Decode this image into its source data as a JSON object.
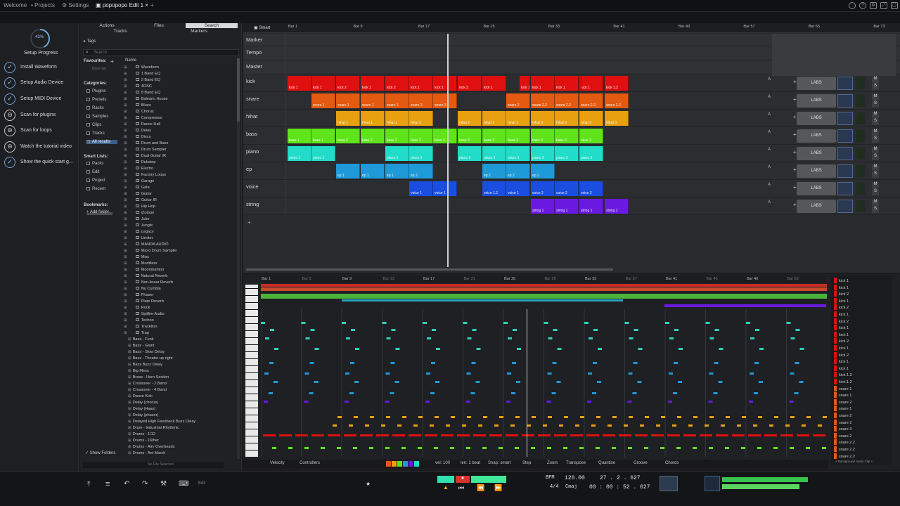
{
  "topbar": {
    "tabs": [
      "Welcome",
      "Projects",
      "Settings",
      "popopopo Edit 1"
    ],
    "add_tab": "+"
  },
  "setup": {
    "progress_pct": "43%",
    "progress_value": 0.43,
    "title": "Setup Progress",
    "items": [
      "Install Waveform",
      "Setup Audio Device",
      "Setup MIDI Device",
      "Scan for plugins",
      "Scan for loops",
      "Watch the tutorial video",
      "Show the quick start g..."
    ]
  },
  "browser": {
    "tabs": [
      "Actions",
      "Files",
      "Search",
      "Tracks",
      "Markers"
    ],
    "tags": "Tags",
    "search_placeholder": "Search",
    "favourites": "Favourites:",
    "none_set": "None set",
    "name_header": "Name",
    "categories_title": "Categories:",
    "categories": [
      "Plugins",
      "Presets",
      "Racks",
      "Samples",
      "Clips",
      "Tracks",
      "All results"
    ],
    "smart_title": "Smart Lists:",
    "smart": [
      "Packs",
      "Edit",
      "Project",
      "Recent"
    ],
    "bookmarks_title": "Bookmarks:",
    "add_folder": "Add folder...",
    "folders": [
      "Waveform",
      "1 Band EQ",
      "2 Band EQ",
      "4OSC",
      "8 Band EQ",
      "Balearic House",
      "Blues",
      "Chorus",
      "Compressor",
      "Dance Hall",
      "Delay",
      "Disco",
      "Drum and Bass",
      "Drum Sampler",
      "Dual Guitar IR",
      "Dubstep",
      "Electro",
      "Factory Loops",
      "Garage",
      "Gate",
      "Guitar",
      "Guitar IR",
      "Hip Hop",
      "iZotope",
      "Juke",
      "Jungle",
      "Legacy",
      "Limiter",
      "MANDA AUDIO",
      "Micro Drum Sampler",
      "Misc",
      "Modifiers",
      "Moombahton",
      "Natural Reverb",
      "Non-linear Reverb",
      "Nu Cumbia",
      "Phaser",
      "Plate Reverb",
      "Rock",
      "Spitfire Audio",
      "Techno",
      "Tracktion",
      "Trap"
    ],
    "presets": [
      "Bass - Funk",
      "Bass - Giant",
      "Bass - Slow Delay",
      "Bass - Theatre up right",
      "Bass Buzz Delay",
      "Big Mess",
      "Brass - Horn Section",
      "Crossover - 2 Band",
      "Crossover - 4 Band",
      "Dance Kick",
      "Delay (chorus)",
      "Delay (Haas)",
      "Delay (phaser)",
      "Delayed High Feedback Buzz Delay",
      "Drum - Industrial Rhythmic",
      "Drums - 1/12",
      "Drums - 16ther",
      "Drums - Airy Overheads",
      "Drums - Ant March"
    ],
    "show_folders": "Show Folders",
    "no_file": "No File Selected"
  },
  "arranger": {
    "smart": "Smart",
    "bars": [
      "Bar 1",
      "Bar 9",
      "Bar 17",
      "Bar 25",
      "Bar 33",
      "Bar 41",
      "Bar 49",
      "Bar 57",
      "Bar 65",
      "Bar 73"
    ],
    "tracks": [
      "Marker",
      "Tempo",
      "Master",
      "kick",
      "snare",
      "hihat",
      "bass",
      "piano",
      "ep",
      "voice",
      "string"
    ],
    "labs": "LABS",
    "colors": {
      "kick": "#e01010",
      "snare": "#e35a10",
      "hihat": "#e8a010",
      "bass": "#5fe31a",
      "piano": "#20dcc8",
      "ep": "#1e9ad8",
      "voice": "#1a4ee0",
      "string": "#6a1ae0"
    },
    "clips": {
      "kick": [
        "kick 1",
        "kick 1",
        "kick 2",
        "kick 1",
        "kick 2",
        "kick 1",
        "kick 1",
        "kick 2",
        "kick 1",
        "kick 1",
        "kick 1",
        "kick 1",
        "kick 1",
        "kick 1.2",
        "kick 1.2"
      ],
      "snare": [
        "snare 1",
        "snare 1",
        "snare 1",
        "snare 1",
        "snare 2",
        "snare 2",
        "snare 2",
        "snare 2.2",
        "snare 2.2",
        "snare 2.2",
        "snare 2.2"
      ],
      "hihat": [
        "hihat 1",
        "hihat 1",
        "hihat 1",
        "hihat 2",
        "hihat 2",
        "hihat 1",
        "hihat 1",
        "hihat 3",
        "hihat 3",
        "hihat 3",
        "hihat 3"
      ],
      "bass": [
        "bass 1",
        "bass 1",
        "bass 2",
        "bass 2",
        "bass 2",
        "bass 2",
        "bass 3",
        "bass 3",
        "bass 3",
        "bass 3",
        "bass 3",
        "bass 3",
        "bass 3"
      ],
      "piano": [
        "piano 1",
        "piano 1",
        "piano 2",
        "piano 2",
        "piano 2",
        "piano 2",
        "piano 3",
        "piano 3",
        "piano 3",
        "piano 3"
      ],
      "ep": [
        "ep 1",
        "ep 1",
        "ep 1",
        "ep 2",
        "ep 2",
        "ep 2",
        "ep 2"
      ],
      "voice": [
        "voice 1",
        "voice 1",
        "voice 1.2",
        "voice 1",
        "voice 2",
        "voice 2",
        "voice 2"
      ],
      "string": [
        "string 1",
        "string 1",
        "string 1",
        "string 1"
      ]
    }
  },
  "editor": {
    "bars": [
      "Bar 1",
      "Bar 5",
      "Bar 9",
      "Bar 13",
      "Bar 17",
      "Bar 21",
      "Bar 25",
      "Bar 29",
      "Bar 33",
      "Bar 37",
      "Bar 41",
      "Bar 45",
      "Bar 49",
      "Bar 53"
    ],
    "footer": [
      "Velocity",
      "Controllers",
      "vel: 100",
      "len: 1 beat",
      "Snap: smart",
      "Step",
      "Zoom",
      "Transpose",
      "Quantise",
      "Groove",
      "Chords"
    ],
    "right_list": [
      "kick 1",
      "kick 1",
      "kick 2",
      "kick 1",
      "kick 2",
      "kick 1",
      "kick 2",
      "kick 1",
      "kick 1",
      "kick 2",
      "kick 1",
      "kick 2",
      "kick 1",
      "kick 1",
      "kick 1.2",
      "kick 1.2",
      "snare 1",
      "snare 1",
      "snare 2",
      "snare 1",
      "snare 2",
      "snare 2",
      "snare 3",
      "snare 2",
      "snare 2.2",
      "snare 2.2",
      "snare 2.2"
    ],
    "right_footer": "+ Background Audio Clip +"
  },
  "transport": {
    "edit": "Edit",
    "bpm_label": "BPM",
    "bpm": "120.00",
    "sig": "4/4",
    "key": "Cmaj",
    "bars_pos": "27 . 2 . 627",
    "time_pos": "00 : 00 : 52 . 627"
  }
}
